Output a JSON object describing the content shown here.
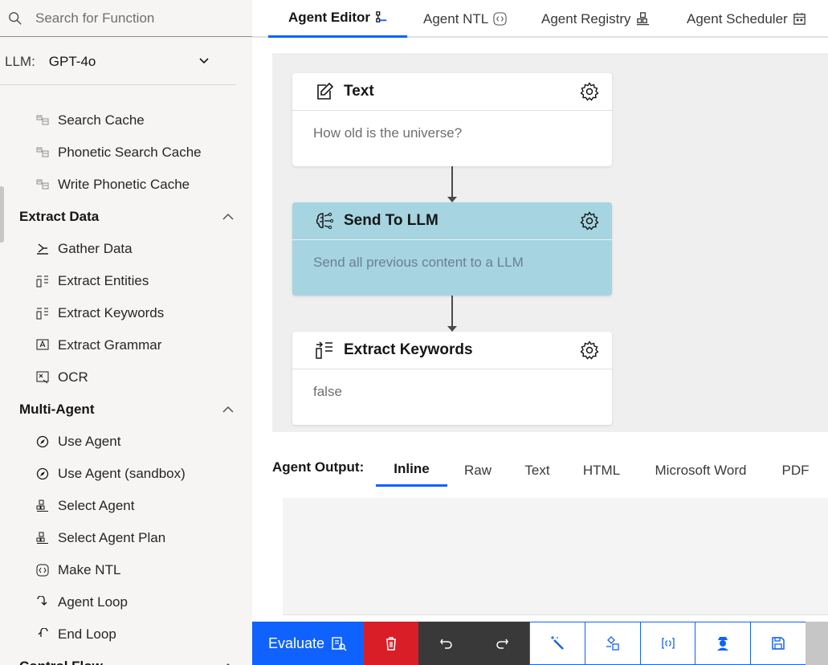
{
  "search": {
    "placeholder": "Search for Function"
  },
  "llm": {
    "label": "LLM:",
    "value": "GPT-4o"
  },
  "sidebar": {
    "items_top": [
      {
        "label": "Search Cache",
        "icon": "cache-icon"
      },
      {
        "label": "Phonetic Search Cache",
        "icon": "cache-icon"
      },
      {
        "label": "Write Phonetic Cache",
        "icon": "cache-icon"
      }
    ],
    "groups": [
      {
        "label": "Extract Data",
        "items": [
          {
            "label": "Gather Data",
            "icon": "gather-icon"
          },
          {
            "label": "Extract Entities",
            "icon": "extract-icon"
          },
          {
            "label": "Extract Keywords",
            "icon": "extract-icon"
          },
          {
            "label": "Extract Grammar",
            "icon": "grammar-icon"
          },
          {
            "label": "OCR",
            "icon": "ocr-icon"
          }
        ]
      },
      {
        "label": "Multi-Agent",
        "items": [
          {
            "label": "Use Agent",
            "icon": "compass-icon"
          },
          {
            "label": "Use Agent (sandbox)",
            "icon": "compass-icon"
          },
          {
            "label": "Select Agent",
            "icon": "registry-icon"
          },
          {
            "label": "Select Agent Plan",
            "icon": "registry-icon"
          },
          {
            "label": "Make NTL",
            "icon": "code-icon"
          },
          {
            "label": "Agent Loop",
            "icon": "loop-icon"
          },
          {
            "label": "End Loop",
            "icon": "end-loop-icon"
          }
        ]
      },
      {
        "label": "Control Flow"
      }
    ]
  },
  "tabs": [
    {
      "label": "Agent Editor",
      "icon": "flow-icon",
      "active": true
    },
    {
      "label": "Agent NTL",
      "icon": "code-icon"
    },
    {
      "label": "Agent Registry",
      "icon": "registry-icon"
    },
    {
      "label": "Agent Scheduler",
      "icon": "calendar-icon"
    }
  ],
  "nodes": [
    {
      "title": "Text",
      "body": "How old is the universe?",
      "icon": "edit-icon"
    },
    {
      "title": "Send To LLM",
      "body": "Send all previous content to a LLM",
      "icon": "brain-icon",
      "selected": true
    },
    {
      "title": "Extract Keywords",
      "body": "false",
      "icon": "extract-icon"
    }
  ],
  "output": {
    "label": "Agent Output:",
    "tabs": [
      "Inline",
      "Raw",
      "Text",
      "HTML",
      "Microsoft Word",
      "PDF"
    ],
    "active": "Inline"
  },
  "toolbar": {
    "evaluate_label": "Evaluate",
    "buttons": [
      "delete-icon",
      "undo-icon",
      "redo-icon",
      "magic-wand-icon",
      "debug-icon",
      "json-icon",
      "agent-icon",
      "save-icon"
    ]
  },
  "colors": {
    "accent": "#0f62fe",
    "danger": "#da1e28",
    "selected_node": "#a6d4e1",
    "sidebar_bg": "#f6f5f4"
  }
}
